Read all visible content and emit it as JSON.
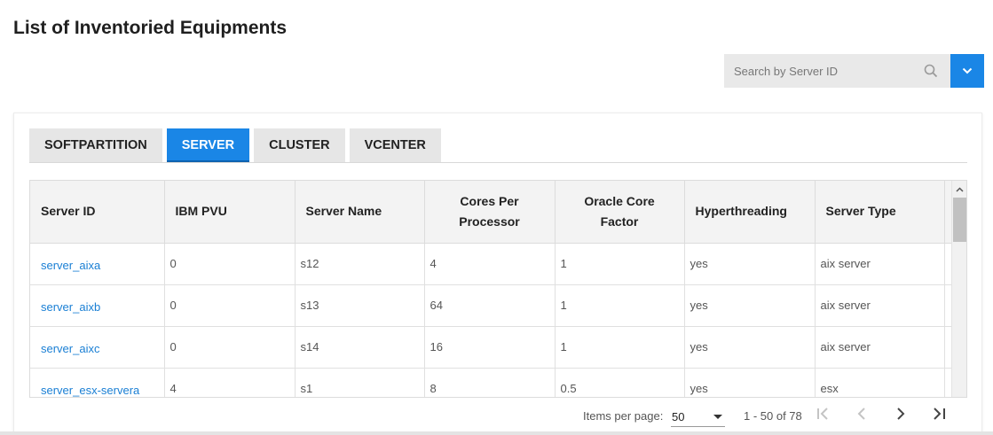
{
  "page": {
    "title": "List of Inventoried Equipments"
  },
  "search": {
    "placeholder": "Search by Server ID",
    "value": ""
  },
  "icons": {
    "search": "search-icon",
    "dropdown": "chevron-down-icon",
    "scroll_up": "chevron-up-icon"
  },
  "colors": {
    "accent": "#1a86e6",
    "link": "#1a7fd4",
    "tab_inactive": "#e6e6e6"
  },
  "tabs": [
    {
      "label": "SOFTPARTITION",
      "active": false
    },
    {
      "label": "SERVER",
      "active": true
    },
    {
      "label": "CLUSTER",
      "active": false
    },
    {
      "label": "VCENTER",
      "active": false
    }
  ],
  "table": {
    "headers": [
      "Server ID",
      "IBM PVU",
      "Server Name",
      "Cores Per Processor",
      "Oracle Core Factor",
      "Hyperthreading",
      "Server Type"
    ],
    "rows": [
      {
        "server_id": "server_aixa",
        "ibm_pvu": "0",
        "server_name": "s12",
        "cores": "4",
        "oracle_core_factor": "1",
        "hyperthreading": "yes",
        "server_type": "aix server"
      },
      {
        "server_id": "server_aixb",
        "ibm_pvu": "0",
        "server_name": "s13",
        "cores": "64",
        "oracle_core_factor": "1",
        "hyperthreading": "yes",
        "server_type": "aix server"
      },
      {
        "server_id": "server_aixc",
        "ibm_pvu": "0",
        "server_name": "s14",
        "cores": "16",
        "oracle_core_factor": "1",
        "hyperthreading": "yes",
        "server_type": "aix server"
      },
      {
        "server_id": "server_esx-servera",
        "ibm_pvu": "4",
        "server_name": "s1",
        "cores": "8",
        "oracle_core_factor": "0.5",
        "hyperthreading": "yes",
        "server_type": "esx"
      }
    ]
  },
  "paginator": {
    "items_per_page_label": "Items per page:",
    "items_per_page_value": "50",
    "range_label": "1 - 50 of 78"
  }
}
